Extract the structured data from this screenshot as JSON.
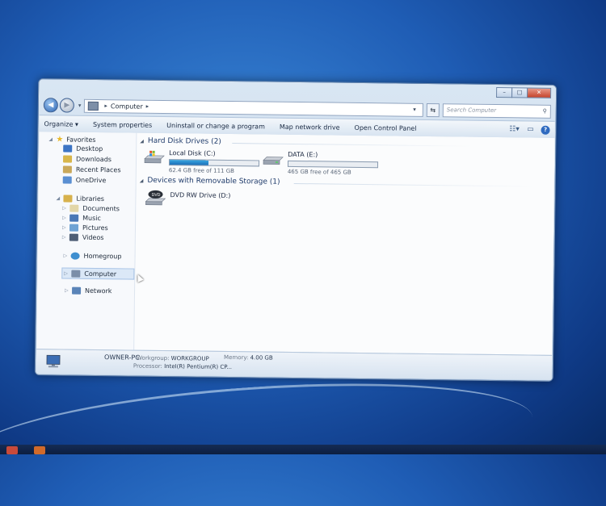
{
  "window": {
    "address": {
      "location": "Computer"
    },
    "search_placeholder": "Search Computer",
    "caption": {
      "minimize": "–",
      "maximize": "□",
      "close": "✕"
    }
  },
  "toolbar": {
    "organize": "Organize ▾",
    "system_properties": "System properties",
    "uninstall": "Uninstall or change a program",
    "map_drive": "Map network drive",
    "control_panel": "Open Control Panel"
  },
  "nav": {
    "favorites": "Favorites",
    "desktop": "Desktop",
    "downloads": "Downloads",
    "recent": "Recent Places",
    "onedrive": "OneDrive",
    "libraries": "Libraries",
    "documents": "Documents",
    "music": "Music",
    "pictures": "Pictures",
    "videos": "Videos",
    "homegroup": "Homegroup",
    "computer": "Computer",
    "network": "Network"
  },
  "content": {
    "hard_disk_header": "Hard Disk Drives (2)",
    "removable_header": "Devices with Removable Storage (1)",
    "drives": [
      {
        "name": "Local Disk (C:)",
        "free": "62.4 GB free of 111 GB",
        "used_fraction": 0.44
      },
      {
        "name": "DATA (E:)",
        "free": "465 GB free of 465 GB",
        "used_fraction": 0.0
      }
    ],
    "dvd": {
      "name": "DVD RW Drive (D:)"
    }
  },
  "details": {
    "pc_name": "OWNER-PC",
    "workgroup_label": "Workgroup:",
    "workgroup": "WORKGROUP",
    "memory_label": "Memory:",
    "memory": "4.00 GB",
    "processor_label": "Processor:",
    "processor": "Intel(R) Pentium(R) CP..."
  },
  "colors": {
    "bar_fill": "#1c6fb8",
    "desktop": "#1f5db5"
  }
}
